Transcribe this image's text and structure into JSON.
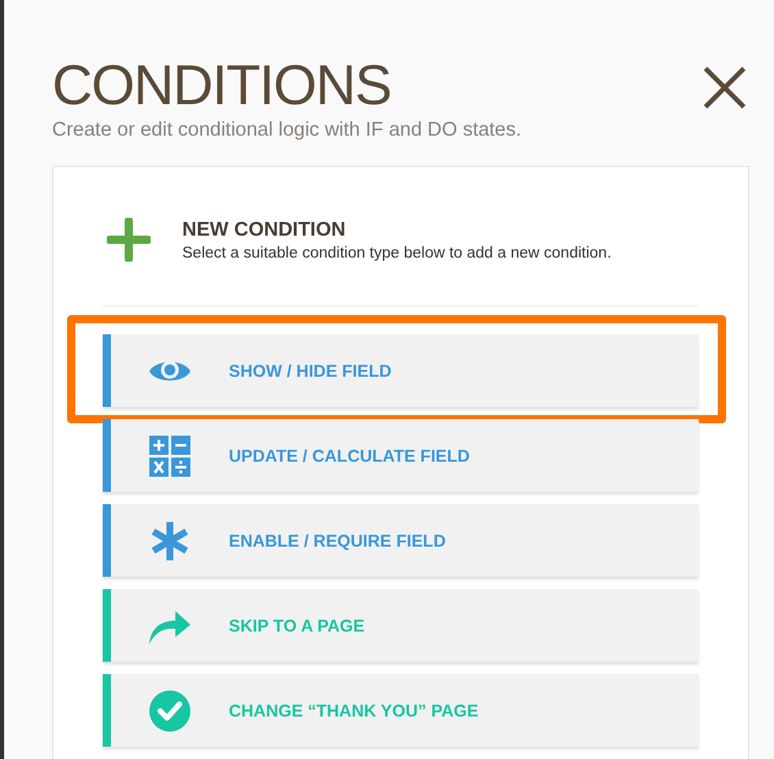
{
  "title": "CONDITIONS",
  "subtitle": "Create or edit conditional logic with IF and DO states.",
  "new_condition": {
    "title": "NEW CONDITION",
    "description": "Select a suitable condition type below to add a new condition."
  },
  "condition_types": [
    {
      "kind": "eye",
      "label": "SHOW / HIDE FIELD",
      "color": "#3a97d9",
      "highlighted": true
    },
    {
      "kind": "calc",
      "label": "UPDATE / CALCULATE FIELD",
      "color": "#3a97d9",
      "highlighted": false
    },
    {
      "kind": "asterisk",
      "label": "ENABLE / REQUIRE FIELD",
      "color": "#3a97d9",
      "highlighted": false
    },
    {
      "kind": "arrow",
      "label": "SKIP TO A PAGE",
      "color": "#17c6a3",
      "highlighted": false
    },
    {
      "kind": "check",
      "label": "CHANGE “THANK YOU” PAGE",
      "color": "#17c6a3",
      "highlighted": false
    }
  ]
}
